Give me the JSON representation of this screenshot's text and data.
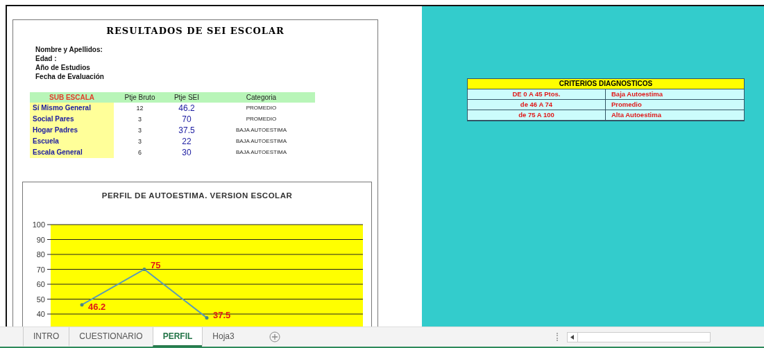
{
  "report": {
    "title": "RESULTADOS DE SEI ESCOLAR",
    "fields": [
      "Nombre y Apellidos:",
      "Edad :",
      "Año de Estudios",
      "Fecha de Evaluación"
    ],
    "table": {
      "columns": [
        "SUB ESCALA",
        "Ptje Bruto",
        "Ptje SEI",
        "Categoria"
      ],
      "rows": [
        {
          "subscale": "Sí Mismo General",
          "raw": "12",
          "sei": "46.2",
          "category": "PROMEDIO"
        },
        {
          "subscale": "Social Pares",
          "raw": "3",
          "sei": "70",
          "category": "PROMEDIO"
        },
        {
          "subscale": "Hogar  Padres",
          "raw": "3",
          "sei": "37.5",
          "category": "BAJA AUTOESTIMA"
        },
        {
          "subscale": "Escuela",
          "raw": "3",
          "sei": "22",
          "category": "BAJA AUTOESTIMA"
        },
        {
          "subscale": "Escala General",
          "raw": "6",
          "sei": "30",
          "category": "BAJA AUTOESTIMA"
        }
      ]
    },
    "chart": {
      "chart_data": {
        "type": "line",
        "grid": true,
        "title": "PERFIL  DE  AUTOESTIMA. VERSION  ESCOLAR",
        "categories": [
          null,
          null,
          null,
          null,
          null
        ],
        "ylim": [
          30,
          100
        ],
        "yticks": [
          40,
          50,
          60,
          70,
          80,
          90,
          100
        ],
        "series": [
          {
            "color": "#5b9bb5",
            "values": [
              46.2,
              70,
              37.5,
              null,
              null
            ]
          }
        ],
        "value_labels": [
          "46.2",
          "75",
          "37.5",
          null,
          null
        ]
      }
    }
  },
  "criteria": {
    "title": "CRITERIOS DIAGNOSTICOS",
    "rows": [
      {
        "range": "DE 0 A 45 Ptos.",
        "label": "Baja Autoestima"
      },
      {
        "range": "de 46 A 74",
        "label": "Promedio"
      },
      {
        "range": "de 75 A 100",
        "label": "Alta Autoestima"
      }
    ]
  },
  "sheet_tabs": [
    {
      "label": "INTRO",
      "selected": false
    },
    {
      "label": "CUESTIONARIO",
      "selected": false
    },
    {
      "label": "PERFIL",
      "selected": true
    },
    {
      "label": "Hoja3",
      "selected": false
    }
  ]
}
